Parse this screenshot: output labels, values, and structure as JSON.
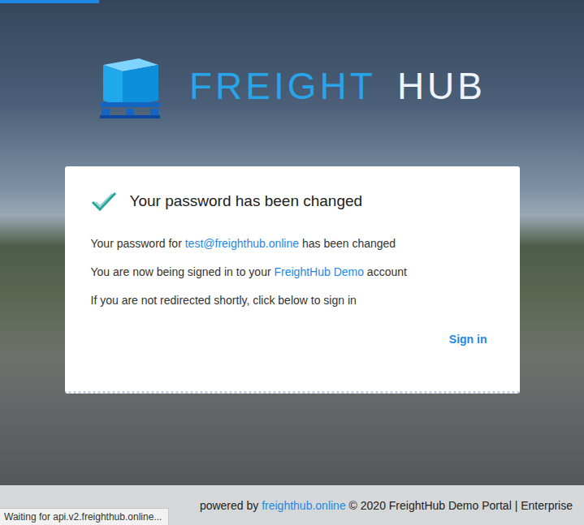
{
  "loading_bar": {
    "level": 0.17
  },
  "logo": {
    "word1": "FREIGHT",
    "word2": "HUB"
  },
  "card": {
    "title": "Your password has been changed",
    "lines": [
      [
        {
          "text": "Your password for ",
          "link": false
        },
        {
          "text": "test@freighthub.online",
          "link": true
        },
        {
          "text": " has been changed",
          "link": false
        }
      ],
      [
        {
          "text": "You are now being signed in to your ",
          "link": false
        },
        {
          "text": "FreightHub Demo",
          "link": true
        },
        {
          "text": " account",
          "link": false
        }
      ],
      [
        {
          "text": "If you are not redirected shortly, click below to sign in",
          "link": false
        }
      ]
    ],
    "sign_in": "Sign in"
  },
  "footer": [
    {
      "text": "powered by ",
      "link": true,
      "plain": true
    },
    {
      "text": "freighthub.online",
      "link": true,
      "plain": false
    },
    {
      "text": " © 2020 FreightHub Demo Portal | Enterprise",
      "link": false,
      "plain": true
    }
  ],
  "status_bar": "Waiting for api.v2.freighthub.online..."
}
